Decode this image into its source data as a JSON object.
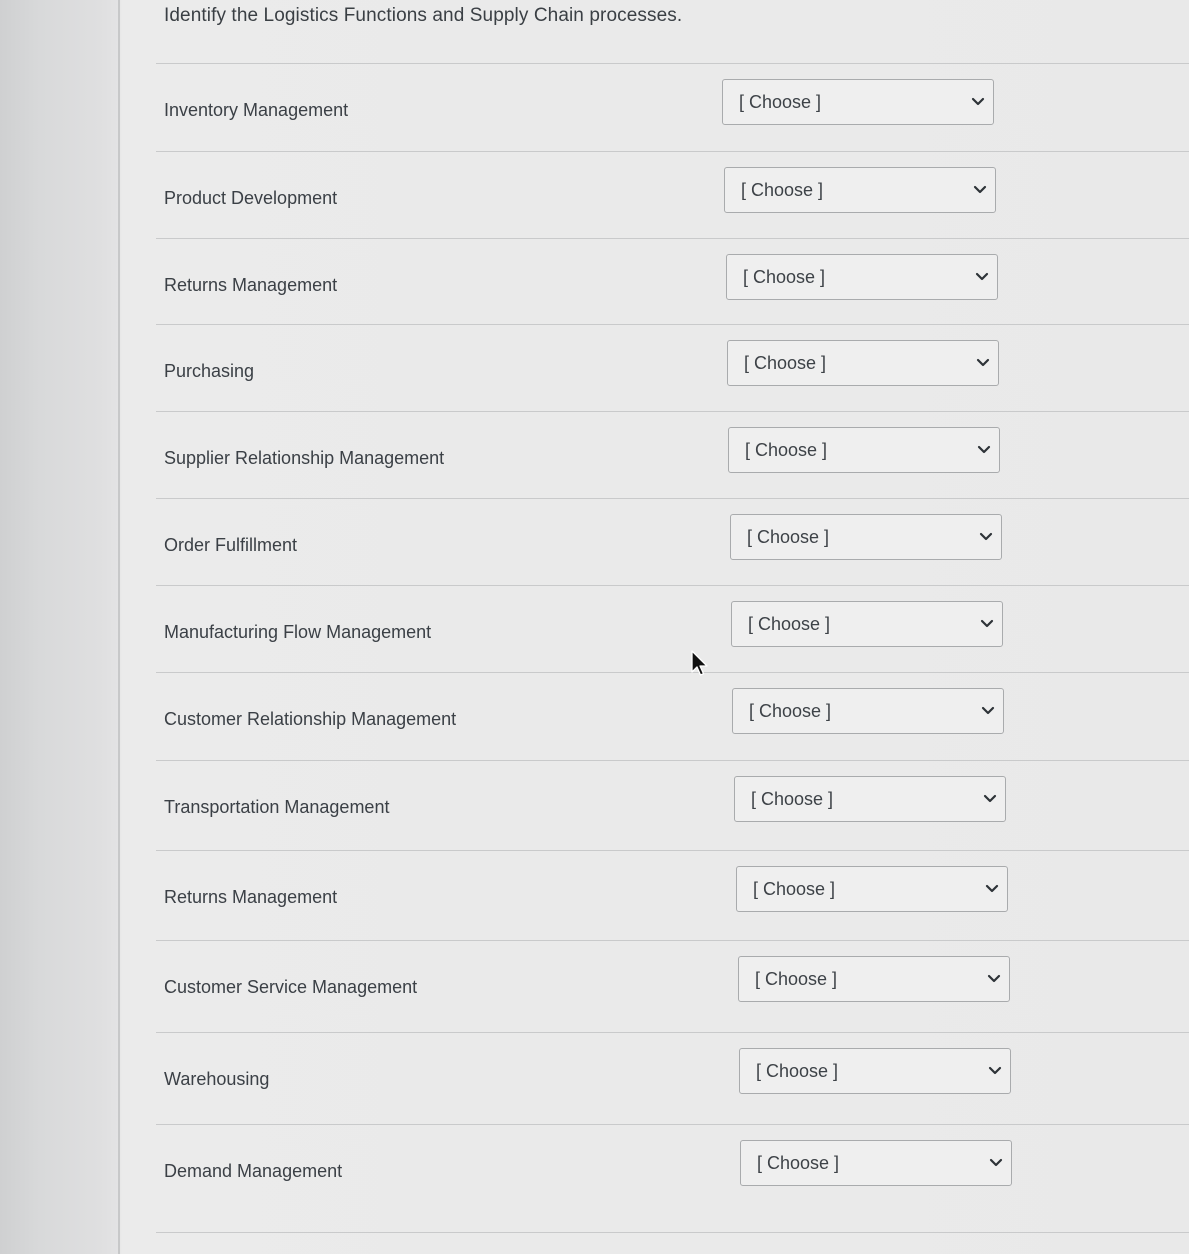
{
  "question": {
    "title": "Identify the Logistics Functions and Supply Chain processes."
  },
  "rows": [
    {
      "label": "Inventory Management",
      "value": "[ Choose ]"
    },
    {
      "label": "Product Development",
      "value": "[ Choose ]"
    },
    {
      "label": "Returns Management",
      "value": "[ Choose ]"
    },
    {
      "label": "Purchasing",
      "value": "[ Choose ]"
    },
    {
      "label": "Supplier Relationship Management",
      "value": "[ Choose ]"
    },
    {
      "label": "Order Fulfillment",
      "value": "[ Choose ]"
    },
    {
      "label": "Manufacturing Flow Management",
      "value": "[ Choose ]"
    },
    {
      "label": "Customer Relationship Management",
      "value": "[ Choose ]"
    },
    {
      "label": "Transportation Management",
      "value": "[ Choose ]"
    },
    {
      "label": "Returns Management",
      "value": "[ Choose ]"
    },
    {
      "label": "Customer Service Management",
      "value": "[ Choose ]"
    },
    {
      "label": "Warehousing",
      "value": "[ Choose ]"
    },
    {
      "label": "Demand Management",
      "value": "[ Choose ]"
    }
  ],
  "icons": {
    "dropdown": "chevron-down-icon",
    "pointer": "mouse-cursor-icon"
  }
}
